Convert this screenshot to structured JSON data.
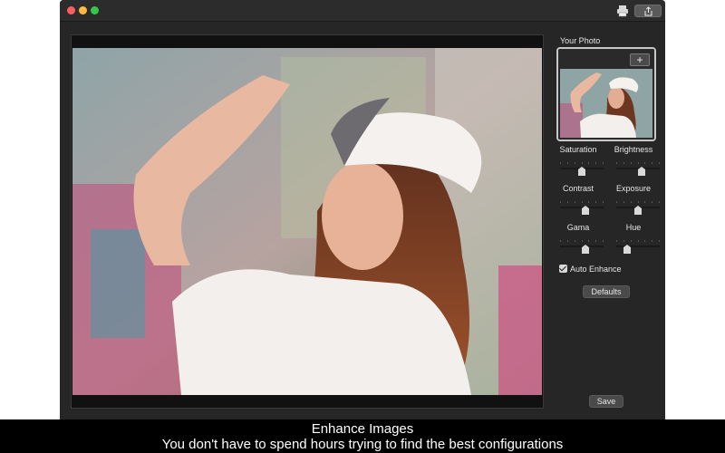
{
  "window": {
    "toolbar": {
      "print_icon": "printer-icon",
      "share_icon": "share-icon"
    }
  },
  "panel": {
    "title": "Your Photo",
    "add_label": "+",
    "sliders": [
      {
        "label": "Saturation",
        "value": 0.5
      },
      {
        "label": "Brightness",
        "value": 0.6
      },
      {
        "label": "Contrast",
        "value": 0.6
      },
      {
        "label": "Exposure",
        "value": 0.5
      },
      {
        "label": "Gama",
        "value": 0.6
      },
      {
        "label": "Hue",
        "value": 0.2
      }
    ],
    "auto_enhance": {
      "label": "Auto Enhance",
      "checked": true
    },
    "defaults_label": "Defaults",
    "save_label": "Save"
  },
  "caption": {
    "title": "Enhance Images",
    "subtitle": "You don't have to spend hours trying to find the best configurations"
  },
  "colors": {
    "window_bg": "#262626",
    "caption_bg": "#000000"
  }
}
